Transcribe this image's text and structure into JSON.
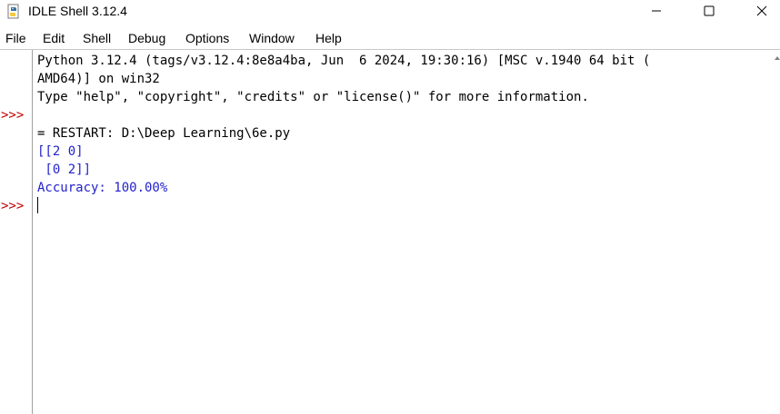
{
  "window": {
    "title": "IDLE Shell 3.12.4"
  },
  "icons": {
    "app": "python-idle-icon",
    "minimize": "minimize-icon",
    "maximize": "maximize-icon",
    "close": "close-icon"
  },
  "menu": {
    "items": [
      "File",
      "Edit",
      "Shell",
      "Debug",
      "Options",
      "Window",
      "Help"
    ]
  },
  "shell": {
    "prompts": [
      ">>>",
      ">>>"
    ],
    "banner_lines": [
      "Python 3.12.4 (tags/v3.12.4:8e8a4ba, Jun  6 2024, 19:30:16) [MSC v.1940 64 bit (",
      "AMD64)] on win32",
      "Type \"help\", \"copyright\", \"credits\" or \"license()\" for more information."
    ],
    "restart_line": "= RESTART: D:\\Deep Learning\\6e.py",
    "output_lines": [
      "[[2 0]",
      " [0 2]]",
      "Accuracy: 100.00%"
    ]
  },
  "colors": {
    "prompt": "#c00000",
    "output": "#2222cc",
    "text": "#000000"
  }
}
